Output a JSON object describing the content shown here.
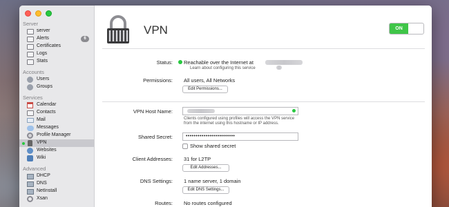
{
  "sidebar": {
    "sections": {
      "server": "Server",
      "accounts": "Accounts",
      "services": "Services",
      "advanced": "Advanced"
    },
    "items": {
      "server": "server",
      "alerts": "Alerts",
      "alerts_badge": "6",
      "certificates": "Certificates",
      "logs": "Logs",
      "stats": "Stats",
      "users": "Users",
      "groups": "Groups",
      "calendar": "Calendar",
      "contacts": "Contacts",
      "mail": "Mail",
      "messages": "Messages",
      "profile_manager": "Profile Manager",
      "vpn": "VPN",
      "websites": "Websites",
      "wiki": "Wiki",
      "dhcp": "DHCP",
      "dns": "DNS",
      "netinstall": "NetInstall",
      "xsan": "Xsan"
    },
    "selected": "vpn"
  },
  "header": {
    "title": "VPN",
    "toggle_label": "ON"
  },
  "status": {
    "label": "Status:",
    "value": "Reachable over the Internet at",
    "help_text": "Learn about configuring this service"
  },
  "permissions": {
    "label": "Permissions:",
    "value": "All users, All Networks",
    "button": "Edit Permissions..."
  },
  "host": {
    "label": "VPN Host Name:",
    "help_line1": "Clients configured using profiles will access the VPN service",
    "help_line2": "from the internet using this hostname or IP address."
  },
  "secret": {
    "label": "Shared Secret:",
    "value": "•••••••••••••••••••••••••",
    "show_label": "Show shared secret"
  },
  "addresses": {
    "label": "Client Addresses:",
    "value": "31 for L2TP",
    "button": "Edit Addresses..."
  },
  "dns": {
    "label": "DNS Settings:",
    "value": "1 name server, 1 domain",
    "button": "Edit DNS Settings..."
  },
  "routes": {
    "label": "Routes:",
    "value": "No routes configured"
  },
  "colors": {
    "accent_green": "#3fc548",
    "status_dot": "#28c840",
    "selection": "#c9c9ce"
  }
}
